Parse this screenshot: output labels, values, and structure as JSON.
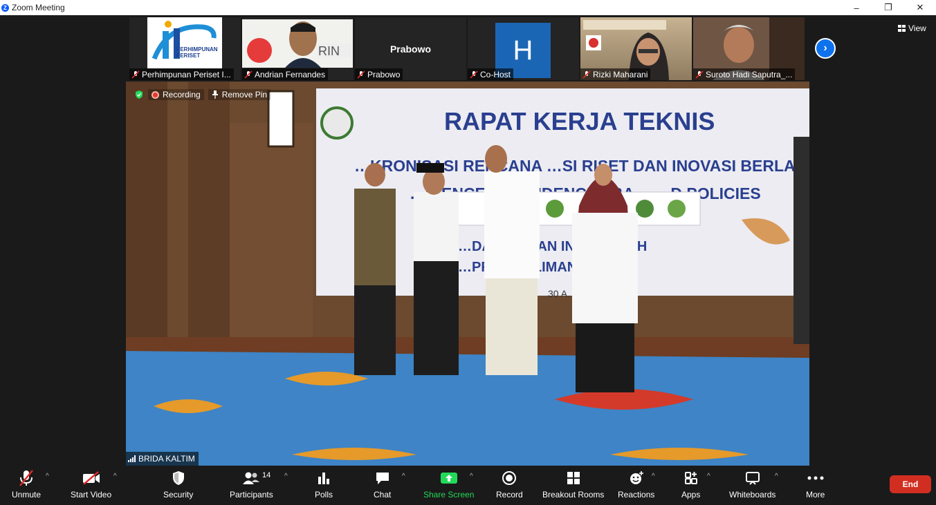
{
  "window": {
    "title": "Zoom Meeting",
    "buttons": [
      "–",
      "❐",
      "✕"
    ]
  },
  "participants_strip": [
    {
      "name": "Perhimpunan Periset I..."
    },
    {
      "name": "Andrian Fernandes"
    },
    {
      "name": "Prabowo",
      "display": "Prabowo"
    },
    {
      "name": "Co-Host",
      "avatar_letter": "H"
    },
    {
      "name": "Rizki Maharani"
    },
    {
      "name": "Suroto Hadi Saputra_..."
    }
  ],
  "logo_text": "PERHIMPUNAN PERISET",
  "view_label": "View",
  "stage": {
    "recording_label": "Recording",
    "remove_pin_label": "Remove Pin",
    "speaker_name": "BRIDA KALTIM",
    "banner_title": "RAPAT KERJA TEKNIS",
    "banner_line2": "…KRONISASI RENCANA …SI RISET DAN INOVASI BERLANDASKA…",
    "banner_line3": "…CIENCE A… …IDENCE - BA… …D POLICIES",
    "banner_line4": "…DAN … …AN INO… …RAH",
    "banner_line5": "…PRO… …LIMAN… …R",
    "banner_date": "30 A…",
    "accent": "#2a3f8f"
  },
  "toolbar": {
    "unmute": "Unmute",
    "start_video": "Start Video",
    "security": "Security",
    "participants": "Participants",
    "participants_count": "14",
    "polls": "Polls",
    "chat": "Chat",
    "share_screen": "Share Screen",
    "record": "Record",
    "breakout_rooms": "Breakout Rooms",
    "reactions": "Reactions",
    "apps": "Apps",
    "whiteboards": "Whiteboards",
    "more": "More",
    "end": "End",
    "share_color": "#23d959",
    "end_color": "#d12e22"
  }
}
